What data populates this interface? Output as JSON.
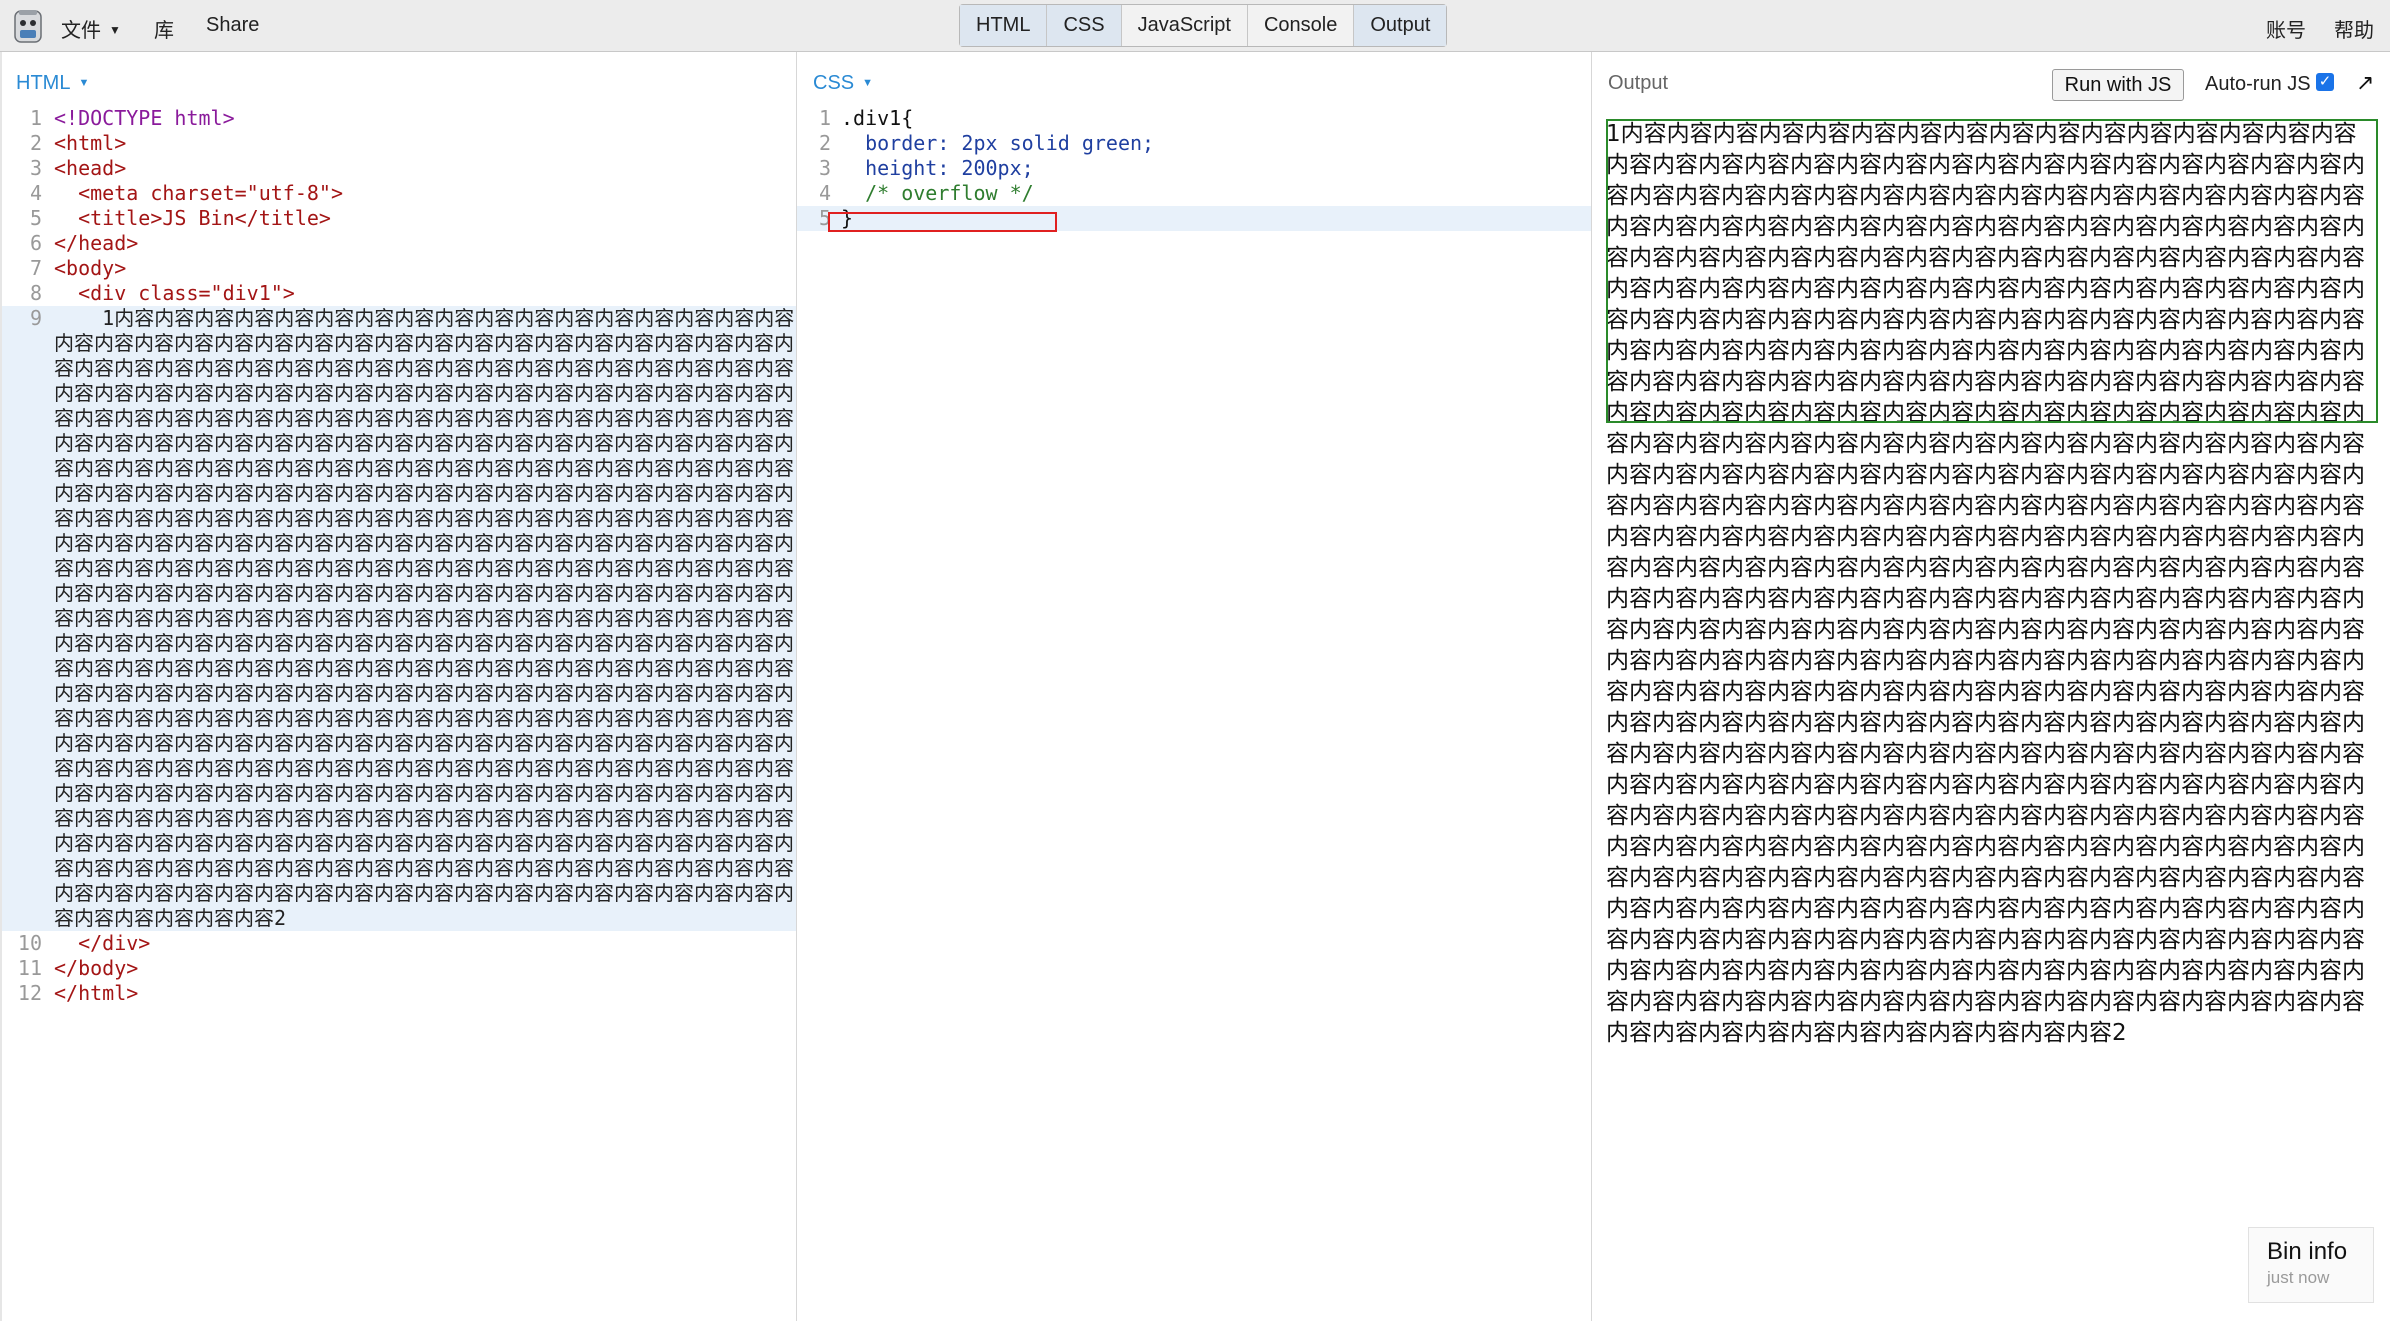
{
  "topbar": {
    "file_label": "文件",
    "library_label": "库",
    "share_label": "Share",
    "account_label": "账号",
    "help_label": "帮助"
  },
  "tabs": [
    {
      "label": "HTML",
      "active": true
    },
    {
      "label": "CSS",
      "active": true
    },
    {
      "label": "JavaScript",
      "active": false
    },
    {
      "label": "Console",
      "active": false
    },
    {
      "label": "Output",
      "active": true
    }
  ],
  "html_panel": {
    "label": "HTML",
    "lines": [
      "<!DOCTYPE html>",
      "<html>",
      "<head>",
      "  <meta charset=\"utf-8\">",
      "  <title>JS Bin</title>",
      "</head>",
      "<body>",
      "  <div class=\"div1\">",
      "    1内容内容内容内容内容内容内容内容内容内容内容内容内容内容内容内容内容内容内容内容内容内容内容内容内容内容内容内容内容内容内容内容内容内容内容内容内容内容内容内容内容内容内容内容内容内容内容内容内容内容内容内容内容内容内容内容内容内容内容内容内容内容内容内容内容内容内容内容内容内容内容内容内容内容内容内容内容内容内容内容内容内容内容内容内容内容内容内容内容内容内容内容内容内容内容内容内容内容内容内容内容内容内容内容内容内容内容内容内容内容内容内容内容内容内容内容内容内容内容内容内容内容内容内容内容内容内容内容内容内容内容内容内容内容内容内容内容内容内容内容内容内容内容内容内容内容内容内容内容内容内容内容内容内容内容内容内容内容内容内容内容内容内容内容内容内容内容内容内容内容内容内容内容内容内容内容内容内容内容内容内容内容内容内容内容内容内容内容内容内容内容内容内容内容内容内容内容内容内容内容内容内容内容内容内容内容内容内容内容内容内容内容内容内容内容内容内容内容内容内容内容内容内容内容内容内容内容内容内容内容内容内容内容内容内容内容内容内容内容内容内容内容内容内容内容内容内容内容内容内容内容内容内容内容内容内容内容内容内容内容内容内容内容内容内容内容内容内容内容内容内容内容内容内容内容内容内容内容内容内容内容内容内容内容内容内容内容内容内容内容内容内容内容内容内容内容内容内容内容内容内容内容内容内容内容内容内容内容内容内容内容内容内容内容内容内容内容内容内容内容内容内容内容内容内容内容内容内容内容内容内容内容内容内容内容内容内容内容内容内容内容内容内容内容内容内容内容内容内容内容内容内容内容内容内容内容内容内容内容内容内容内容内容内容内容内容内容内容内容内容内容内容内容内容内容内容内容内容内容内容内容内容内容内容内容内容内容内容内容内容内容内容内容内容内容内容内容内容内容内容内容内容内容内容内容内容内容内容内容内容内容内容内容内容内容内容内容内容内容内容内容内容内容内容内容内容内容内容内容内容内容内容内容内容内容内容内容内容内容内容内容内容内容内容内容内容内容内容2",
      "  </div>",
      "</body>",
      "</html>"
    ]
  },
  "css_panel": {
    "label": "CSS",
    "lines": [
      ".div1{",
      "  border: 2px solid green;",
      "  height: 200px;",
      "  /* overflow */",
      "}"
    ]
  },
  "output_panel": {
    "title": "Output",
    "run_button": "Run with JS",
    "autorun_label": "Auto-run JS",
    "autorun_checked": true,
    "content": "1内容内容内容内容内容内容内容内容内容内容内容内容内容内容内容内容内容内容内容内容内容内容内容内容内容内容内容内容内容内容内容内容内容内容内容内容内容内容内容内容内容内容内容内容内容内容内容内容内容内容内容内容内容内容内容内容内容内容内容内容内容内容内容内容内容内容内容内容内容内容内容内容内容内容内容内容内容内容内容内容内容内容内容内容内容内容内容内容内容内容内容内容内容内容内容内容内容内容内容内容内容内容内容内容内容内容内容内容内容内容内容内容内容内容内容内容内容内容内容内容内容内容内容内容内容内容内容内容内容内容内容内容内容内容内容内容内容内容内容内容内容内容内容内容内容内容内容内容内容内容内容内容内容内容内容内容内容内容内容内容内容内容内容内容内容内容内容内容内容内容内容内容内容内容内容内容内容内容内容内容内容内容内容内容内容内容内容内容内容内容内容内容内容内容内容内容内容内容内容内容内容内容内容内容内容内容内容内容内容内容内容内容内容内容内容内容内容内容内容内容内容内容内容内容内容内容内容内容内容内容内容内容内容内容内容内容内容内容内容内容内容内容内容内容内容内容内容内容内容内容内容内容内容内容内容内容内容内容内容内容内容内容内容内容内容内容内容内容内容内容内容内容内容内容内容内容内容内容内容内容内容内容内容内容内容内容内容内容内容内容内容内容内容内容内容内容内容内容内容内容内容内容内容内容内容内容内容内容内容内容内容内容内容内容内容内容内容内容内容内容内容内容内容内容内容内容内容内容内容内容内容内容内容内容内容内容内容内容内容内容内容内容内容内容内容内容内容内容内容内容内容内容内容内容内容内容内容内容内容内容内容内容内容内容内容内容内容内容内容内容内容内容内容内容内容内容内容内容内容内容内容内容内容内容内容内容内容内容内容内容内容内容内容内容内容内容内容内容内容内容内容内容内容内容内容内容内容内容内容内容内容内容内容内容内容内容内容内容内容内容内容内容内容内容内容内容内容内容内容内容内容内容内容内容内容内容内容内容内容内容内容内容内容内容内容内容内容内容内容内容内容内容内容内容内容内容内容内容内容内容内容内容内容内容内容内容内容内容内容内容内容内容内容内容内容内容内容内容内容内容内容内容内容内容内容内容内容内容内容2"
  },
  "bin_info": {
    "title": "Bin info",
    "subtitle": "just now"
  },
  "colors": {
    "accent": "#2a8ad4",
    "output_border": "#2a8a2a",
    "highlight_box": "#e02020"
  }
}
